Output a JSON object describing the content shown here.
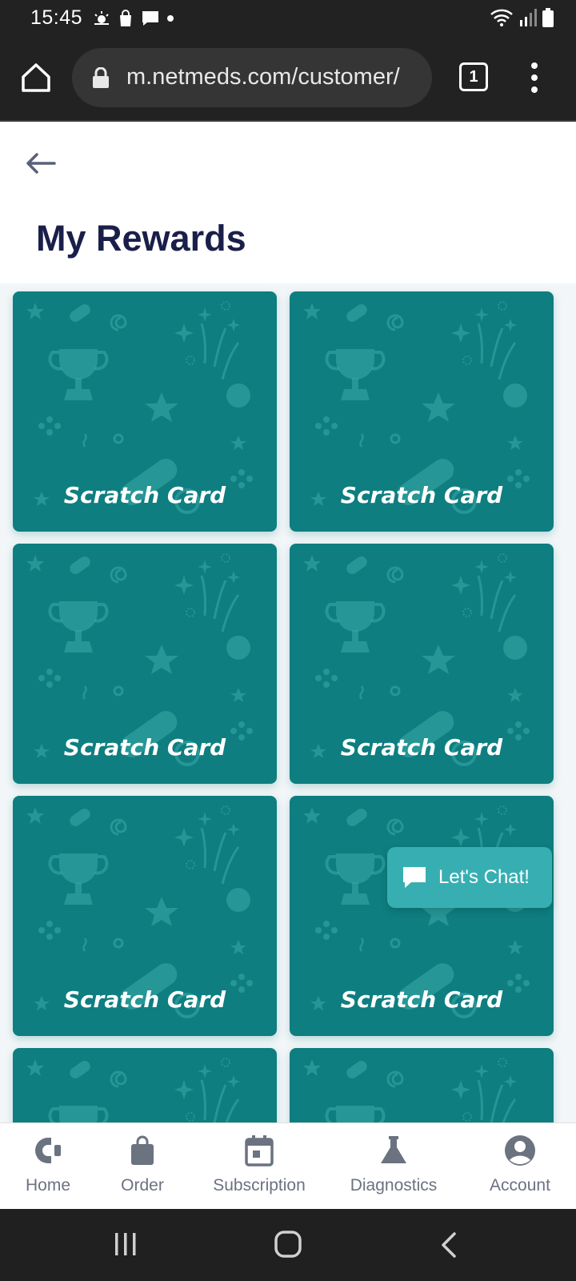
{
  "status_bar": {
    "time": "15:45",
    "left_icons": [
      "weather-icon",
      "shopping-bag-icon",
      "message-icon",
      "dot-icon"
    ],
    "right_icons": [
      "wifi-icon",
      "signal-icon",
      "battery-icon"
    ]
  },
  "browser": {
    "url": "m.netmeds.com/customer/",
    "tab_count": "1"
  },
  "page": {
    "title": "My Rewards"
  },
  "rewards": {
    "card_color": "#0e7e80",
    "cards": [
      {
        "label": "Scratch Card"
      },
      {
        "label": "Scratch Card"
      },
      {
        "label": "Scratch Card"
      },
      {
        "label": "Scratch Card"
      },
      {
        "label": "Scratch Card"
      },
      {
        "label": "Scratch Card"
      },
      {
        "label": ""
      },
      {
        "label": ""
      }
    ]
  },
  "chat": {
    "label": "Let's Chat!",
    "color": "#37afb2"
  },
  "bottom_nav": {
    "items": [
      {
        "label": "Home",
        "icon": "home-icon"
      },
      {
        "label": "Order",
        "icon": "bag-icon"
      },
      {
        "label": "Subscription",
        "icon": "calendar-icon"
      },
      {
        "label": "Diagnostics",
        "icon": "flask-icon"
      },
      {
        "label": "Account",
        "icon": "account-icon"
      }
    ]
  }
}
